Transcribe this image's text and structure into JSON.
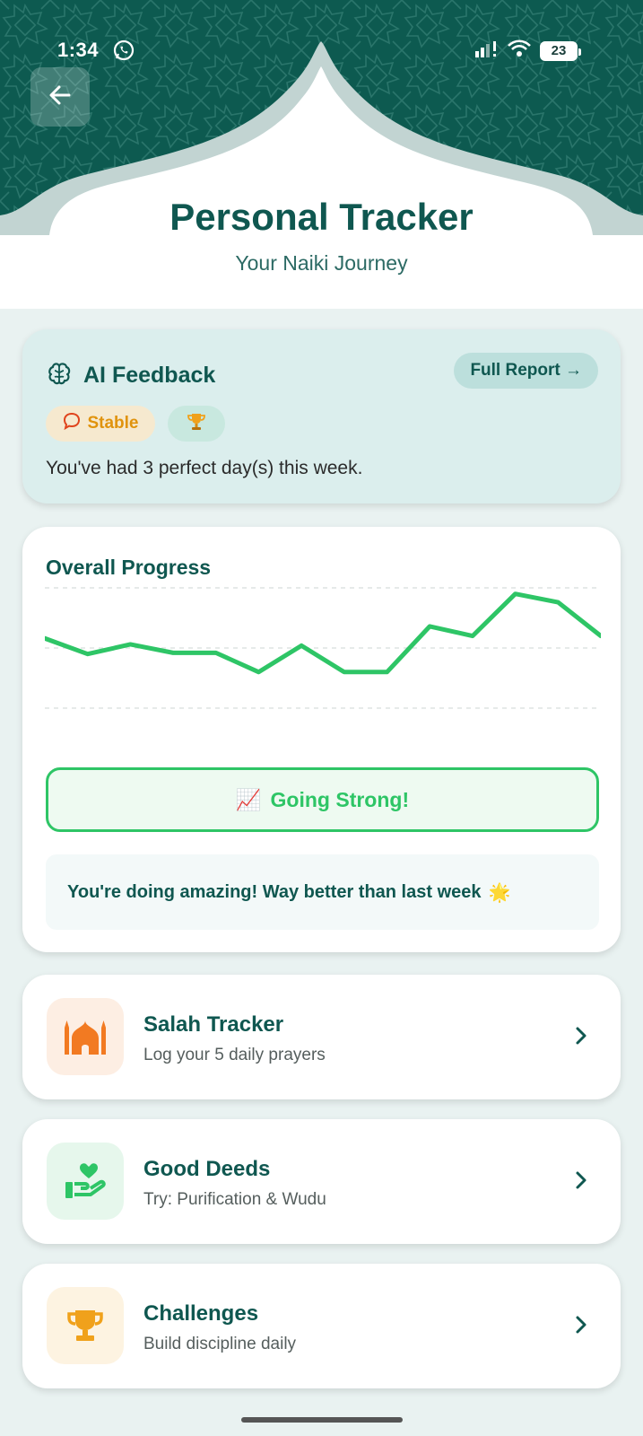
{
  "status_bar": {
    "time": "1:34",
    "battery": "23"
  },
  "header": {
    "title": "Personal Tracker",
    "subtitle": "Your Naiki Journey"
  },
  "ai_feedback": {
    "title": "AI Feedback",
    "full_report_label": "Full Report →",
    "status_badge": "Stable",
    "message": "You've had 3 perfect day(s) this week."
  },
  "overall_progress": {
    "title": "Overall Progress",
    "status_label": "Going Strong!",
    "status_emoji": "📈",
    "encouragement": "You're doing amazing! Way better than last week",
    "encouragement_emoji": "🌟"
  },
  "chart_data": {
    "type": "line",
    "series": [
      {
        "values": [
          0.58,
          0.45,
          0.53,
          0.46,
          0.46,
          0.3,
          0.52,
          0.3,
          0.3,
          0.68,
          0.6,
          0.95,
          0.88,
          0.6
        ]
      }
    ],
    "ylim": [
      0,
      1
    ],
    "grid": true,
    "color": "#2ec566"
  },
  "nav": [
    {
      "title": "Salah Tracker",
      "subtitle": "Log your 5 daily prayers",
      "icon": "mosque-icon",
      "color": "#f27a22"
    },
    {
      "title": "Good Deeds",
      "subtitle": "Try: Purification & Wudu",
      "icon": "hand-heart-icon",
      "color": "#2ec566"
    },
    {
      "title": "Challenges",
      "subtitle": "Build discipline daily",
      "icon": "trophy-icon",
      "color": "#f0a11b"
    }
  ],
  "colors": {
    "primary": "#0f5750",
    "accent_green": "#2ec566",
    "header_pattern": "#0d5a50",
    "background": "#e9f2f1"
  }
}
